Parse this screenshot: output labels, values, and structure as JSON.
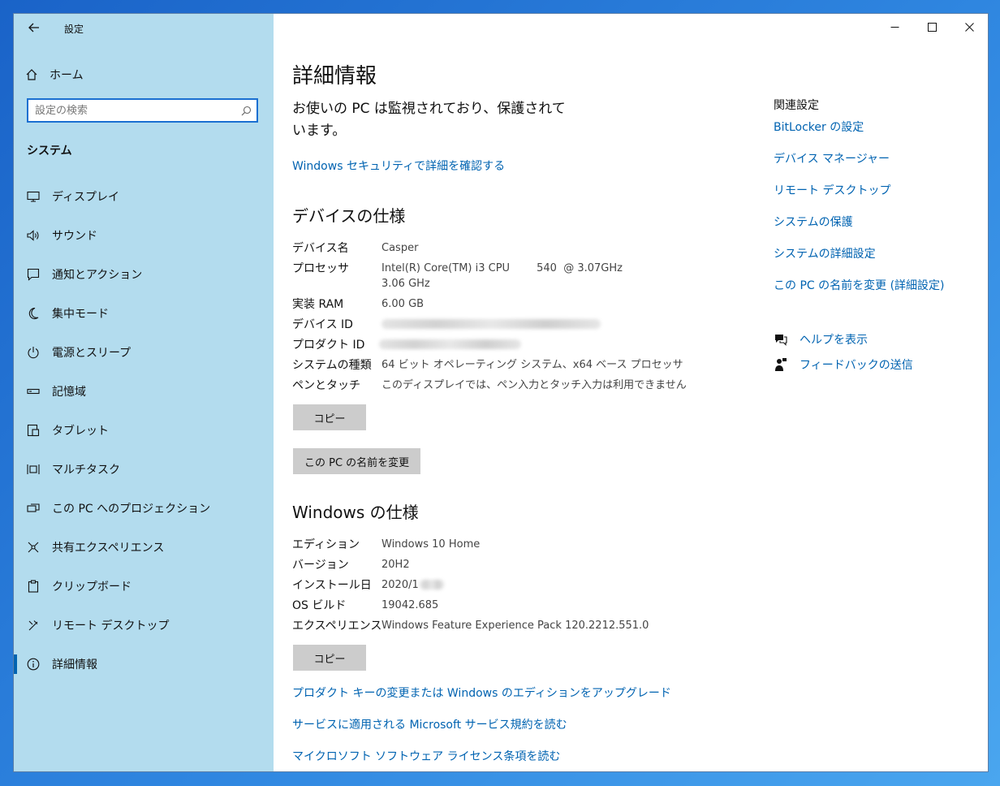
{
  "window": {
    "title": "設定"
  },
  "sidebar": {
    "home_label": "ホーム",
    "search_placeholder": "設定の検索",
    "section_title": "システム",
    "items": [
      {
        "label": "ディスプレイ",
        "icon": "monitor-icon"
      },
      {
        "label": "サウンド",
        "icon": "speaker-icon"
      },
      {
        "label": "通知とアクション",
        "icon": "notification-icon"
      },
      {
        "label": "集中モード",
        "icon": "moon-icon"
      },
      {
        "label": "電源とスリープ",
        "icon": "power-icon"
      },
      {
        "label": "記憶域",
        "icon": "storage-icon"
      },
      {
        "label": "タブレット",
        "icon": "tablet-icon"
      },
      {
        "label": "マルチタスク",
        "icon": "multitask-icon"
      },
      {
        "label": "この PC へのプロジェクション",
        "icon": "projection-icon"
      },
      {
        "label": "共有エクスペリエンス",
        "icon": "share-icon"
      },
      {
        "label": "クリップボード",
        "icon": "clipboard-icon"
      },
      {
        "label": "リモート デスクトップ",
        "icon": "remote-icon"
      },
      {
        "label": "詳細情報",
        "icon": "info-icon",
        "active": true
      }
    ]
  },
  "main": {
    "title": "詳細情報",
    "status": "お使いの PC は監視されており、保護されています。",
    "security_link": "Windows セキュリティで詳細を確認する",
    "device_spec": {
      "heading": "デバイスの仕様",
      "rows": [
        {
          "key": "デバイス名",
          "value": "Casper"
        },
        {
          "key": "プロセッサ",
          "value": "Intel(R) Core(TM) i3 CPU        540  @ 3.07GHz   3.06 GHz"
        },
        {
          "key": "実装 RAM",
          "value": "6.00 GB"
        },
        {
          "key": "デバイス ID",
          "value": ""
        },
        {
          "key": "プロダクト ID",
          "value": ""
        },
        {
          "key": "システムの種類",
          "value": "64 ビット オペレーティング システム、x64 ベース プロセッサ"
        },
        {
          "key": "ペンとタッチ",
          "value": "このディスプレイでは、ペン入力とタッチ入力は利用できません"
        }
      ],
      "copy_button": "コピー",
      "rename_button": "この PC の名前を変更"
    },
    "windows_spec": {
      "heading": "Windows の仕様",
      "rows": [
        {
          "key": "エディション",
          "value": "Windows 10 Home"
        },
        {
          "key": "バージョン",
          "value": "20H2"
        },
        {
          "key": "インストール日",
          "value": "2020/1"
        },
        {
          "key": "OS ビルド",
          "value": "19042.685"
        },
        {
          "key": "エクスペリエンス",
          "value": "Windows Feature Experience Pack 120.2212.551.0"
        }
      ],
      "copy_button": "コピー"
    },
    "links": [
      "プロダクト キーの変更または Windows のエディションをアップグレード",
      "サービスに適用される Microsoft サービス規約を読む",
      "マイクロソフト ソフトウェア ライセンス条項を読む"
    ]
  },
  "related": {
    "heading": "関連設定",
    "links": [
      "BitLocker の設定",
      "デバイス マネージャー",
      "リモート デスクトップ",
      "システムの保護",
      "システムの詳細設定",
      "この PC の名前を変更 (詳細設定)"
    ],
    "help_label": "ヘルプを表示",
    "feedback_label": "フィードバックの送信"
  },
  "colors": {
    "accent": "#0063b1",
    "sidebar_bg": "#b3dcee",
    "button_bg": "#cccccc"
  }
}
